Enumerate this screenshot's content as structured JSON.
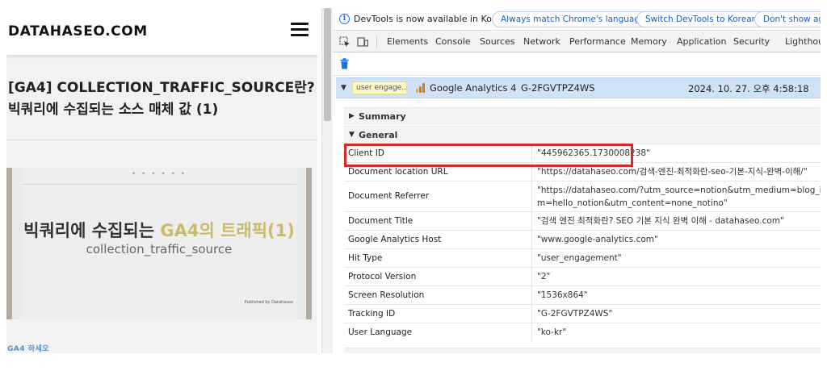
{
  "blog": {
    "site_name": "DATAHASEO.COM",
    "post_title": "[GA4] COLLECTION_TRAFFIC_SOURCE란? 빅쿼리에 수집되는 소스 매체 값 (1)",
    "hero": {
      "dots": "• • •   • • •",
      "main_text": "빅쿼리에 수집되는 ",
      "main_accent": "GA4의 트래픽(1)",
      "sub_text": "collection_traffic_source",
      "publisher": "Published by Datahaseo"
    },
    "category": "GA4 하세오",
    "icons": {
      "menu": "hamburger-menu-icon"
    }
  },
  "devtools": {
    "infobar": {
      "message": "DevTools is now available in Korean!",
      "buttons": [
        "Always match Chrome's language",
        "Switch DevTools to Korean",
        "Don't show agai"
      ]
    },
    "tabs": [
      "Elements",
      "Console",
      "Sources",
      "Network",
      "Performance",
      "Memory",
      "Application",
      "Security",
      "Lighthou"
    ],
    "hit": {
      "badge": "user engage...",
      "name": "Google Analytics 4",
      "tracking_id": "G-2FGVTPZ4WS",
      "timestamp": "2024. 10. 27. 오후 4:58:18",
      "icon_colors": [
        "#f9ab00",
        "#e37400",
        "#e37400"
      ]
    },
    "sections": {
      "summary": "Summary",
      "general": "General"
    },
    "params": [
      {
        "name": "Client ID",
        "value": "\"445962365.1730008238\""
      },
      {
        "name": "Document location URL",
        "value": "\"https://datahaseo.com/검색-엔진-최적화란-seo-기본-지식-완벽-이해/\""
      },
      {
        "name": "Document Referrer",
        "value": "\"https://datahaseo.com/?utm_source=notion&utm_medium=blog_introduction&utm_ter",
        "value2": "m=hello_notion&utm_content=none_notino\""
      },
      {
        "name": "Document Title",
        "value": "\"검색 엔진 최적화란? SEO 기본 지식 완벽 이해 - datahaseo.com\""
      },
      {
        "name": "Google Analytics Host",
        "value": "\"www.google-analytics.com\""
      },
      {
        "name": "Hit Type",
        "value": "\"user_engagement\""
      },
      {
        "name": "Protocol Version",
        "value": "\"2\""
      },
      {
        "name": "Screen Resolution",
        "value": "\"1536x864\""
      },
      {
        "name": "Tracking ID",
        "value": "\"G-2FGVTPZ4WS\""
      },
      {
        "name": "User Language",
        "value": "\"ko-kr\""
      }
    ],
    "highlight_color": "#d52a2a"
  }
}
